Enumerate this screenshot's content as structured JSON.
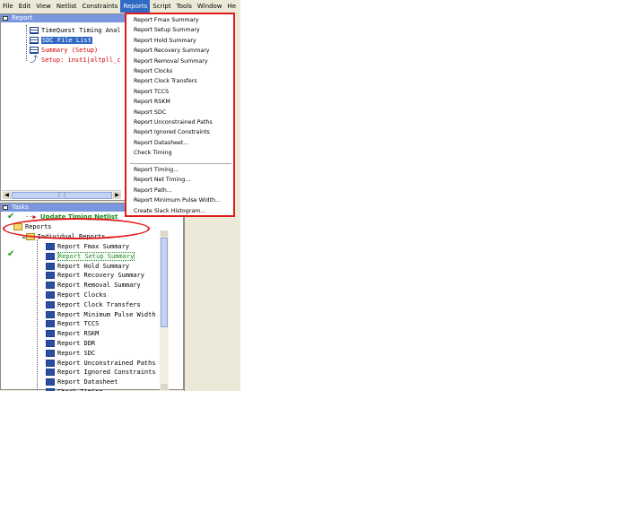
{
  "menubar": {
    "items": [
      "File",
      "Edit",
      "View",
      "Netlist",
      "Constraints",
      "Reports",
      "Script",
      "Tools",
      "Window",
      "He"
    ]
  },
  "report_panel": {
    "title": "Report",
    "items": [
      {
        "label": "TimeQuest Timing Anal"
      },
      {
        "label": "SDC File List"
      },
      {
        "label": "Summary (Setup)"
      },
      {
        "label": "Setup: inst1|altpll_c"
      }
    ]
  },
  "tasks_panel": {
    "title": "Tasks",
    "update_netlist": "Update Timing Netlist",
    "reports_folder": "Reports",
    "individual_folder": "Individual Reports",
    "items": [
      "Report Fmax Summary",
      "Report Setup Summary",
      "Report Hold Summary",
      "Report Recovery Summary",
      "Report Removal Summary",
      "Report Clocks",
      "Report Clock Transfers",
      "Report Minimum Pulse Width",
      "Report TCCS",
      "Report RSKM",
      "Report DDR",
      "Report SDC",
      "Report Unconstrained Paths",
      "Report Ignored Constraints",
      "Report Datasheet",
      "Check Timing"
    ]
  },
  "reports_menu": {
    "group1": [
      "Report Fmax Summary",
      "Report Setup Summary",
      "Report Hold Summary",
      "Report Recovery Summary",
      "Report Removal Summary",
      "Report Clocks",
      "Report Clock Transfers",
      "Report TCCS",
      "Report RSKM",
      "Report SDC",
      "Report Unconstrained Paths",
      "Report Ignored Constraints",
      "Report Datasheet...",
      "Check Timing"
    ],
    "group2": [
      "Report Timing...",
      "Report Net Timing...",
      "Report Path...",
      "Report Minimum Pulse Width...",
      "Create Slack Histogram..."
    ]
  },
  "colors": {
    "highlight": "#e11b1b",
    "selection": "#316ac5",
    "panel_title": "#7a96df",
    "check": "#1b9a1b"
  }
}
